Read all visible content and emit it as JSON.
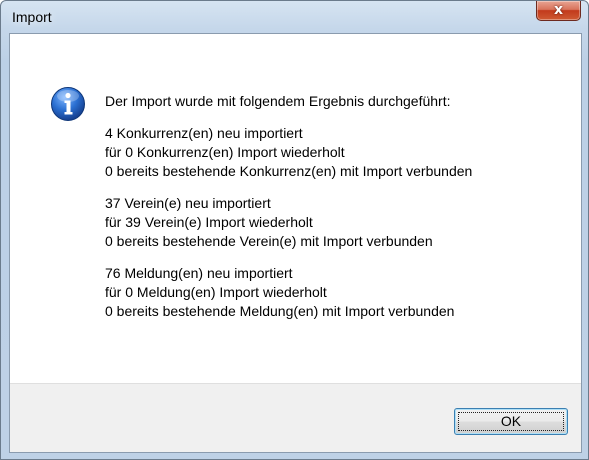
{
  "window": {
    "title": "Import",
    "close_glyph": "x"
  },
  "dialog": {
    "icon": "info-icon",
    "headline": "Der Import wurde mit folgendem Ergebnis durchgeführt:",
    "groups": [
      {
        "lines": [
          "4 Konkurrenz(en) neu importiert",
          "für 0 Konkurrenz(en) Import wiederholt",
          "0 bereits bestehende Konkurrenz(en) mit Import verbunden"
        ]
      },
      {
        "lines": [
          "37 Verein(e) neu importiert",
          "für 39 Verein(e) Import wiederholt",
          "0 bereits bestehende Verein(e) mit Import verbunden"
        ]
      },
      {
        "lines": [
          "76 Meldung(en) neu importiert",
          "für 0 Meldung(en) Import wiederholt",
          "0 bereits bestehende Meldung(en) mit Import verbunden"
        ]
      }
    ]
  },
  "buttons": {
    "ok_label": "OK"
  },
  "colors": {
    "info_icon": "#1f5fb8",
    "close_button": "#c23a1c",
    "ok_border": "#3c7fb1"
  }
}
